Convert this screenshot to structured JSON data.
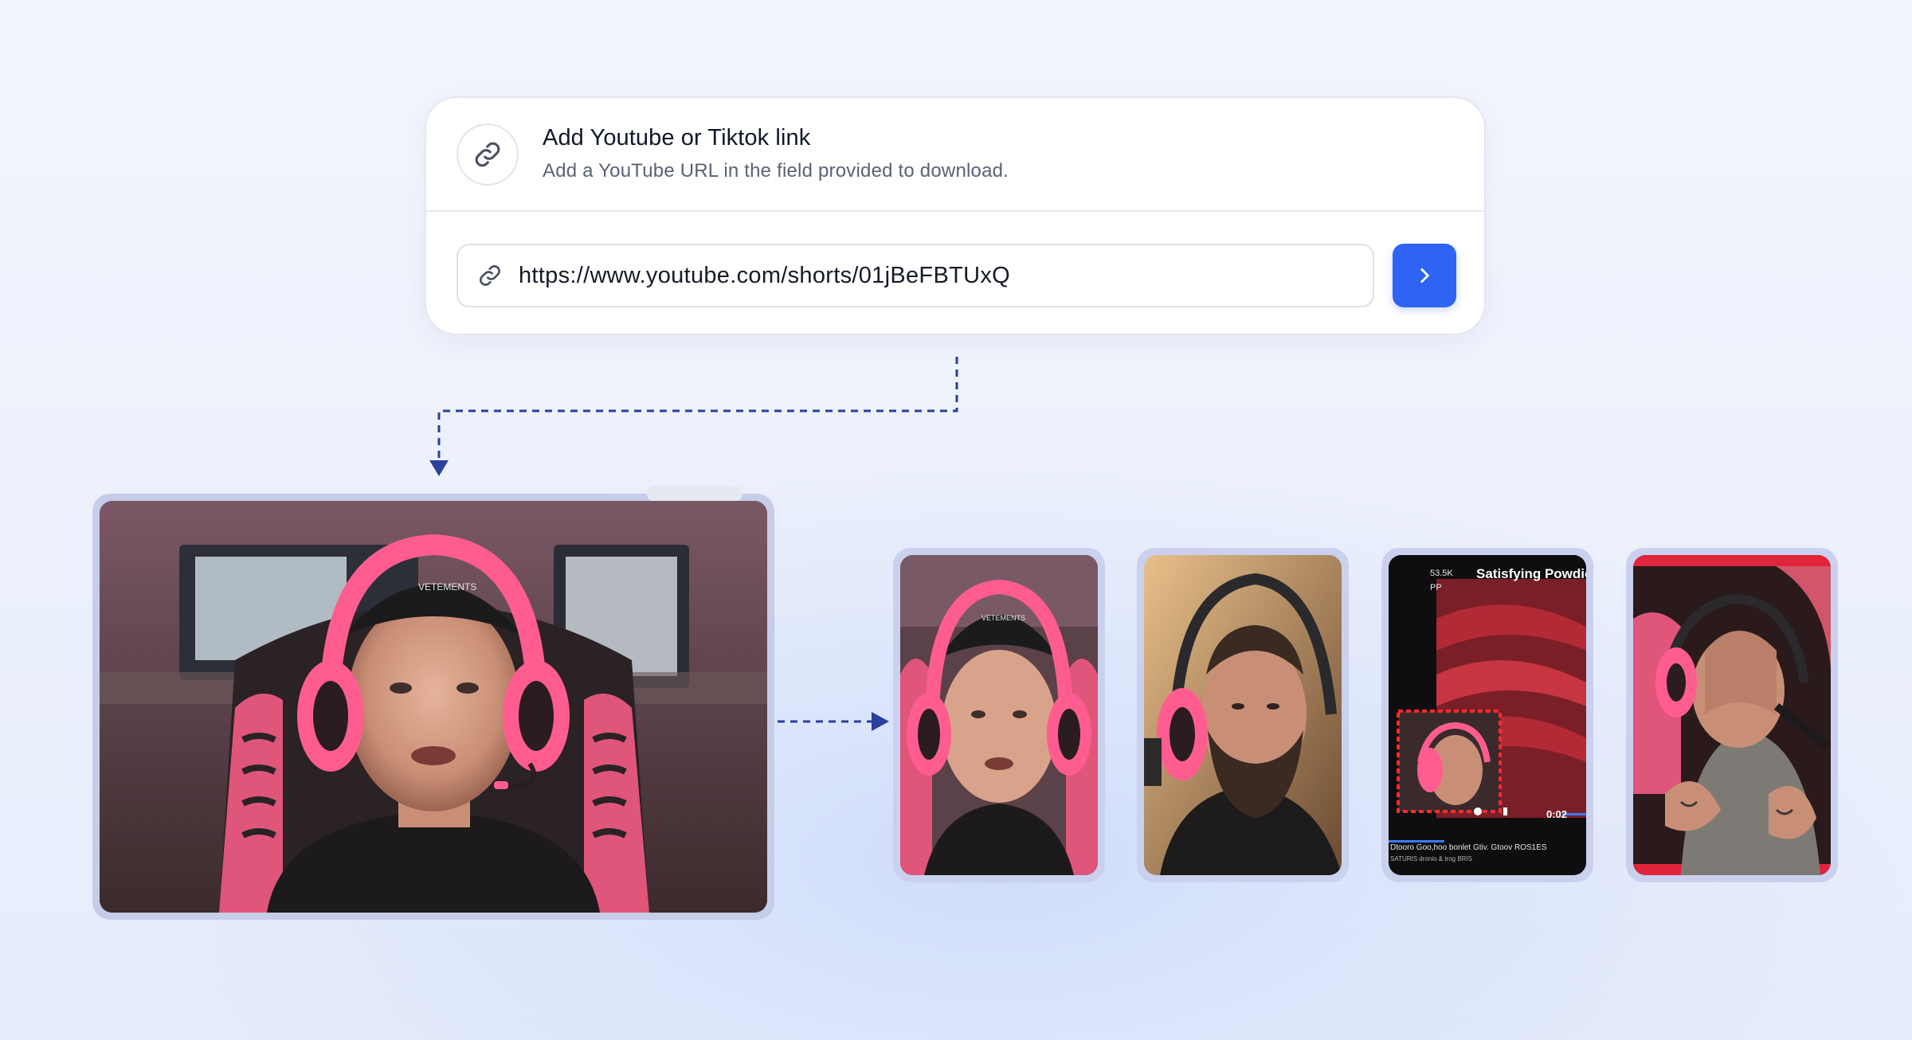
{
  "link_card": {
    "title": "Add Youtube or Tiktok link",
    "subtitle": "Add a YouTube URL in the field provided to download.",
    "url_value": "https://www.youtube.com/shorts/01jBeFBTUxQ",
    "link_icon": "link-icon",
    "submit_icon": "chevron-right-icon"
  },
  "colors": {
    "accent": "#2f63f4",
    "connector": "#2a3f9e",
    "thumb_border": "#c9d1ee"
  },
  "main_video": {
    "cap_text": "VETEMENTS"
  },
  "clips": [
    {
      "cap_text": "VETEMENTS"
    },
    {
      "cap_text": ""
    },
    {
      "count_text": "53.5K",
      "count_sub": "PP",
      "title": "Satisfying Powdio",
      "time": "0:02",
      "caption": "Dtooro Goo,hoo bonlet Gtiv. Gtoov ROS1ES",
      "subcaption": "SATURIS dronio & trog BRIS"
    },
    {
      "cap_text": ""
    }
  ]
}
